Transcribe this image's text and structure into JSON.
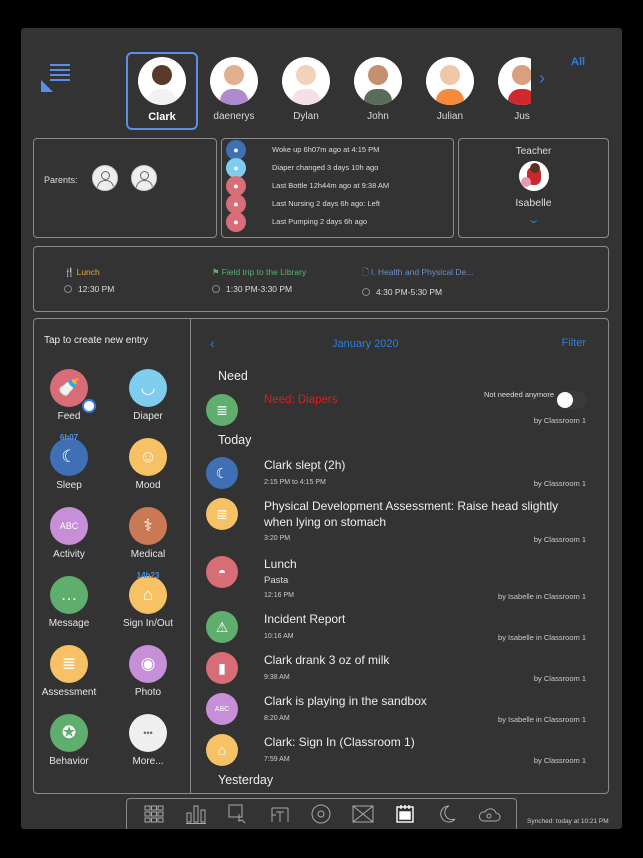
{
  "header": {
    "menu_icon": "list-menu-icon",
    "next_label": "›",
    "all_label": "All"
  },
  "children": [
    {
      "name": "Clark",
      "selected": true
    },
    {
      "name": "daenerys",
      "selected": false
    },
    {
      "name": "Dylan",
      "selected": false
    },
    {
      "name": "John",
      "selected": false
    },
    {
      "name": "Julian",
      "selected": false
    },
    {
      "name": "Jus",
      "selected": false
    }
  ],
  "parents": {
    "label": "Parents:",
    "count": 2
  },
  "status": [
    {
      "icon": "sleep-icon",
      "text": "Woke up  6h07m ago at 4:15 PM",
      "color": "#3f6fb5"
    },
    {
      "icon": "diaper-icon",
      "text": "Diaper changed  3 days 10h ago",
      "color": "#7fcdee"
    },
    {
      "icon": "bottle-icon",
      "text": "Last Bottle  12h44m ago at 9:38 AM",
      "color": "#d86d77"
    },
    {
      "icon": "nursing-icon",
      "text": "Last Nursing  2 days 6h ago: Left",
      "color": "#d86d77"
    },
    {
      "icon": "pumping-icon",
      "text": "Last Pumping  2 days 6h ago",
      "color": "#d86d77"
    }
  ],
  "teacher": {
    "label": "Teacher",
    "name": "Isabelle",
    "expand": "⌄"
  },
  "schedule": [
    {
      "icon": "fork-knife-icon",
      "title": "Lunch",
      "time": "12:30 PM",
      "color": "#e5a93b"
    },
    {
      "icon": "flag-icon",
      "title": "Field trip to the Library",
      "time": "1:30 PM-3:30 PM",
      "color": "#5fae6e"
    },
    {
      "icon": "document-icon",
      "title": "I. Health and Physical De...",
      "time": "4:30 PM-5:30 PM",
      "color": "#6f8fc2"
    }
  ],
  "create": {
    "header": "Tap to create new entry",
    "tiles": [
      {
        "label": "Feed",
        "icon": "feed-icon",
        "color": "#d86d77",
        "glyph": "🍼"
      },
      {
        "label": "Diaper",
        "icon": "diaper-icon",
        "color": "#7fcdee",
        "glyph": "◡"
      },
      {
        "label": "Sleep",
        "icon": "sleep-icon",
        "color": "#3f6fb5",
        "glyph": "☾",
        "overlay": "6h07"
      },
      {
        "label": "Mood",
        "icon": "mood-icon",
        "color": "#f7c266",
        "glyph": "☺"
      },
      {
        "label": "Activity",
        "icon": "blocks-icon",
        "color": "#c78fd7",
        "glyph": "ABC"
      },
      {
        "label": "Medical",
        "icon": "doctor-icon",
        "color": "#c97a55",
        "glyph": "⚕"
      },
      {
        "label": "Message",
        "icon": "message-icon",
        "color": "#5fae6e",
        "glyph": "…"
      },
      {
        "label": "Sign In/Out",
        "icon": "home-icon",
        "color": "#f7c266",
        "glyph": "⌂",
        "overlay": "14h23"
      },
      {
        "label": "Assessment",
        "icon": "assessment-icon",
        "color": "#f7c266",
        "glyph": "≣"
      },
      {
        "label": "Photo",
        "icon": "camera-icon",
        "color": "#c78fd7",
        "glyph": "◉"
      },
      {
        "label": "Behavior",
        "icon": "medal-icon",
        "color": "#5fae6e",
        "glyph": "✪"
      },
      {
        "label": "More...",
        "icon": "more-icon",
        "color": "#efefef",
        "glyph": "•••"
      }
    ]
  },
  "feed": {
    "back": "‹",
    "month": "January 2020",
    "filter": "Filter",
    "need_header": "Need",
    "need": {
      "title": "Need: Diapers",
      "toggle_label": "Not needed anymore",
      "toggle_on": false,
      "by": "by Classroom 1"
    },
    "today_header": "Today",
    "events": [
      {
        "icon": "sleep-icon",
        "color": "#3f6fb5",
        "glyph": "☾",
        "title": "Clark slept (2h)",
        "subtitle": "",
        "time": "2:15 PM to 4:15 PM",
        "by": "by Classroom 1"
      },
      {
        "icon": "assessment-icon",
        "color": "#f7c266",
        "glyph": "≣",
        "title": "Physical Development Assessment: Raise head slightly when lying on stomach",
        "subtitle": "",
        "time": "3:20 PM",
        "by": "by Classroom 1"
      },
      {
        "icon": "bowl-icon",
        "color": "#d86d77",
        "glyph": "◓",
        "title": "Lunch",
        "subtitle": "Pasta",
        "time": "12:16 PM",
        "by": "by Isabelle in Classroom 1"
      },
      {
        "icon": "warning-icon",
        "color": "#5fae6e",
        "glyph": "⚠",
        "title": "Incident Report",
        "subtitle": "",
        "time": "10:16 AM",
        "by": "by Isabelle in Classroom 1"
      },
      {
        "icon": "bottle-icon",
        "color": "#d86d77",
        "glyph": "▮",
        "title": "Clark drank 3 oz of milk",
        "subtitle": "",
        "time": "9:38 AM",
        "by": "by Classroom 1"
      },
      {
        "icon": "blocks-icon",
        "color": "#c78fd7",
        "glyph": "ABC",
        "title": "Clark is playing in the sandbox",
        "subtitle": "",
        "time": "8:20 AM",
        "by": "by Isabelle in Classroom 1"
      },
      {
        "icon": "home-icon",
        "color": "#f7c266",
        "glyph": "⌂",
        "title": "Clark: Sign In (Classroom 1)",
        "subtitle": "",
        "time": "7:59 AM",
        "by": "by Classroom 1"
      }
    ],
    "yesterday_header": "Yesterday"
  },
  "toolbar": {
    "items": [
      {
        "icon": "grid-icon"
      },
      {
        "icon": "bar-chart-icon"
      },
      {
        "icon": "calendar-tap-icon"
      },
      {
        "icon": "classroom-icon"
      },
      {
        "icon": "settings-icon"
      },
      {
        "icon": "mail-icon"
      },
      {
        "icon": "calendar-icon",
        "active": true
      },
      {
        "icon": "night-icon"
      },
      {
        "icon": "cloud-sync-icon"
      }
    ],
    "sync_text": "Synched: today at 10:21 PM"
  }
}
